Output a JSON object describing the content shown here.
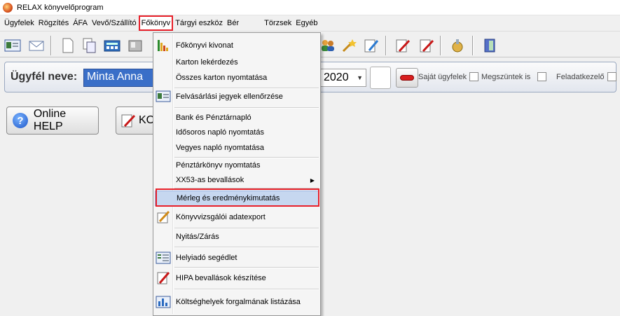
{
  "window": {
    "title": "RELAX könyvelőprogram"
  },
  "menubar": [
    {
      "label": "Ügyfelek"
    },
    {
      "label": "Rögzítés"
    },
    {
      "label": "ÁFA"
    },
    {
      "label": "Vevő/Szállító"
    },
    {
      "label": "Főkönyv",
      "active": true
    },
    {
      "label": "Tárgyi eszköz"
    },
    {
      "label": "Bér"
    },
    {
      "label": "Törzsek"
    },
    {
      "label": "Egyéb"
    }
  ],
  "client_bar": {
    "label": "Ügyfél neve:",
    "client_name": "Minta Anna",
    "year": "2020",
    "checkboxes": [
      {
        "label": "Saját ügyfelek",
        "checked": false
      },
      {
        "label": "Megszüntek is",
        "checked": false
      },
      {
        "label": "Feladatkezelő",
        "checked": false
      }
    ]
  },
  "buttons": {
    "help": "Online HELP",
    "ko": "KO"
  },
  "dropdown": {
    "items": [
      {
        "label": "Főkönyvi kivonat",
        "icon": "ledger-chart-icon"
      },
      {
        "label": "Karton lekérdezés"
      },
      {
        "label": "Összes karton nyomtatása"
      },
      {
        "label": "Felvásárlási jegyek ellenőrzése",
        "icon": "id-card-icon"
      },
      {
        "label": "Bank és Pénztárnapló"
      },
      {
        "label": "Idősoros napló nyomtatás"
      },
      {
        "label": "Vegyes napló nyomtatása"
      },
      {
        "label": "Pénztárkönyv nyomtatás"
      },
      {
        "label": "XX53-as bevallások",
        "submenu": true
      },
      {
        "label": "Mérleg és eredménykimutatás",
        "highlighted": true
      },
      {
        "label": "Könyvvizsgálói adatexport",
        "icon": "export-icon"
      },
      {
        "label": "Nyitás/Zárás"
      },
      {
        "label": "Helyiadó segédlet",
        "icon": "tax-icon"
      },
      {
        "label": "HIPA bevallások készítése",
        "icon": "edit-pencil-icon"
      },
      {
        "label": "Költséghelyek forgalmának listázása",
        "icon": "bar-chart-icon"
      }
    ]
  },
  "colors": {
    "highlight": "#c6d7f0",
    "red_frame": "#e8202a",
    "client_input": "#3a6fc8"
  }
}
